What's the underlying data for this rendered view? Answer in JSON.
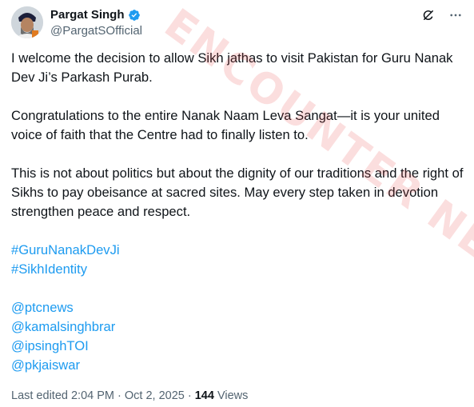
{
  "author": {
    "display_name": "Pargat Singh",
    "handle": "@PargatSOfficial",
    "verified_icon": "verified-badge-icon",
    "accent": "#1d9bf0"
  },
  "actions": {
    "grok_icon": "grok-icon",
    "more_icon": "more-dots-icon"
  },
  "post": {
    "paragraphs": [
      "I welcome the decision to allow Sikh jathas to visit Pakistan for Guru Nanak Dev Ji’s Parkash Purab.",
      "Congratulations to the entire Nanak Naam Leva Sangat—it is your united voice of faith that the Centre had to finally listen to.",
      "This is not about politics but about the dignity of our traditions and the right of Sikhs to pay obeisance at sacred sites. May every step taken in devotion strengthen peace and respect."
    ],
    "hashtags": [
      "#GuruNanakDevJi",
      "#SikhIdentity"
    ],
    "mentions": [
      "@ptcnews",
      "@kamalsinghbrar",
      "@ipsinghTOI",
      "@pkjaiswar"
    ]
  },
  "meta": {
    "edited": "Last edited 2:04 PM · Oct 2, 2025 · ",
    "views_count": "144",
    "views_label": " Views"
  },
  "watermark": "ENCOUNTER NEWS"
}
